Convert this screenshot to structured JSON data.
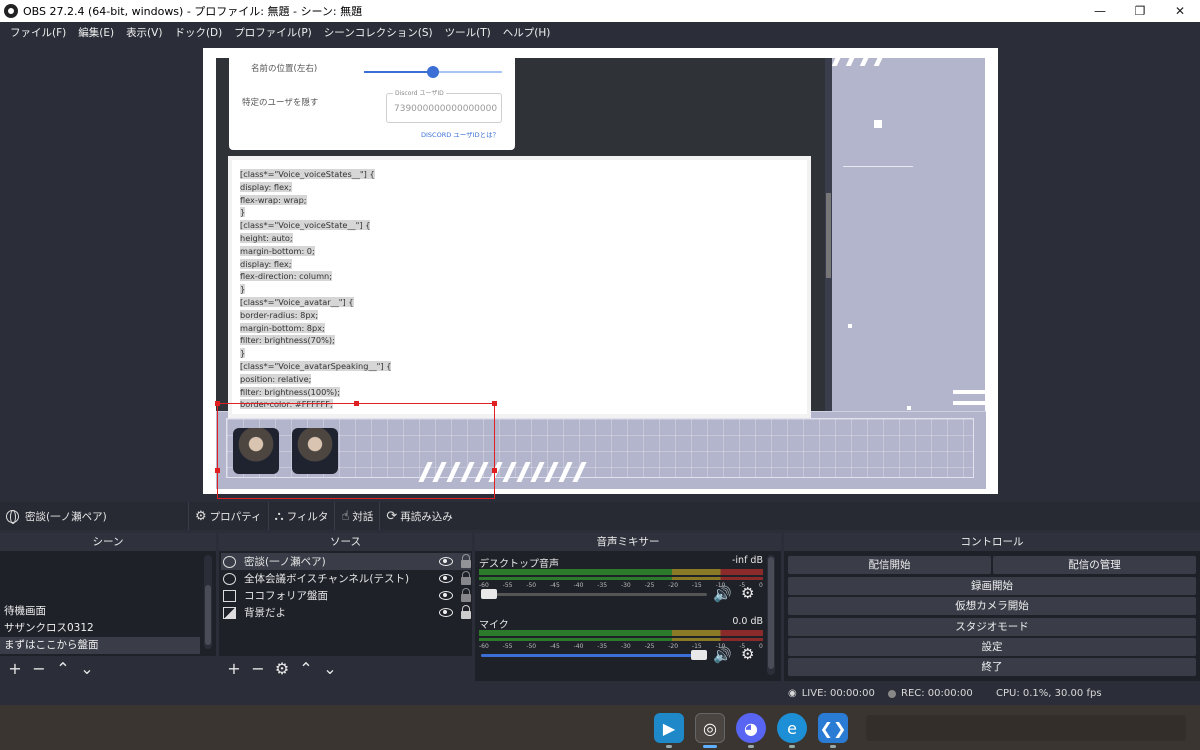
{
  "window": {
    "title": "OBS 27.2.4 (64-bit, windows) - プロファイル: 無題 - シーン: 無題",
    "minimize": "—",
    "restore": "❐",
    "close": "✕"
  },
  "menu": [
    "ファイル(F)",
    "編集(E)",
    "表示(V)",
    "ドック(D)",
    "プロファイル(P)",
    "シーンコレクション(S)",
    "ツール(T)",
    "ヘルプ(H)"
  ],
  "preview": {
    "name_position_label": "名前の位置(左右)",
    "name_position_value": 0.5,
    "hide_user_label": "特定のユーザを隠す",
    "discord_id_legend": "Discord ユーザID",
    "discord_id_value": "739000000000000000",
    "help_link": "DISCORD ユーザIDとは？",
    "css_lines": [
      "[class*=\"Voice_voiceStates__\"] {",
      "  display: flex;",
      "  flex-wrap: wrap;",
      "}",
      "[class*=\"Voice_voiceState__\"] {",
      "  height: auto;",
      "  margin-bottom: 0;",
      "  display: flex;",
      "  flex-direction: column;",
      "}",
      "[class*=\"Voice_avatar__\"] {",
      "  border-radius: 8px;",
      "  margin-bottom: 8px;",
      "  filter: brightness(70%);",
      "}",
      "[class*=\"Voice_avatarSpeaking__\"] {",
      "  position: relative;",
      "  filter: brightness(100%);",
      "  border-color: #FFFFFF;"
    ]
  },
  "source_toolbar": {
    "selected_source": "密談(一ノ瀬ペア)",
    "properties": "プロパティ",
    "filters": "フィルタ",
    "interact": "対話",
    "refresh": "再読み込み"
  },
  "scenes": {
    "title": "シーン",
    "items": [
      "待機画面",
      "サザンクロス0312",
      "まずはここから盤面"
    ],
    "active_index": 2
  },
  "sources": {
    "title": "ソース",
    "items": [
      {
        "label": "密談(一ノ瀬ペア)",
        "icon": "browser-icon",
        "locked": false
      },
      {
        "label": "全体会議ボイスチャンネル(テスト)",
        "icon": "browser-icon",
        "locked": false
      },
      {
        "label": "ココフォリア盤面",
        "icon": "window-icon",
        "locked": false
      },
      {
        "label": "背景だよ",
        "icon": "image-icon",
        "locked": true
      }
    ]
  },
  "mixer": {
    "title": "音声ミキサー",
    "scale": [
      "-60",
      "-55",
      "-50",
      "-45",
      "-40",
      "-35",
      "-30",
      "-25",
      "-20",
      "-15",
      "-10",
      "-5",
      "0"
    ],
    "tracks": [
      {
        "name": "デスクトップ音声",
        "db": "-inf dB",
        "volume": 0.0
      },
      {
        "name": "マイク",
        "db": "0.0 dB",
        "volume": 1.0
      }
    ]
  },
  "controls": {
    "title": "コントロール",
    "start_streaming": "配信開始",
    "manage_broadcast": "配信の管理",
    "start_recording": "録画開始",
    "start_virtual_camera": "仮想カメラ開始",
    "studio_mode": "スタジオモード",
    "settings": "設定",
    "exit": "終了"
  },
  "status": {
    "live": "LIVE: 00:00:00",
    "rec": "REC: 00:00:00",
    "cpu": "CPU: 0.1%, 30.00 fps"
  },
  "colors": {
    "bg": "#2b2e38",
    "dock": "#1f2129",
    "accent": "#3c6fd6",
    "selection": "#e02020"
  }
}
